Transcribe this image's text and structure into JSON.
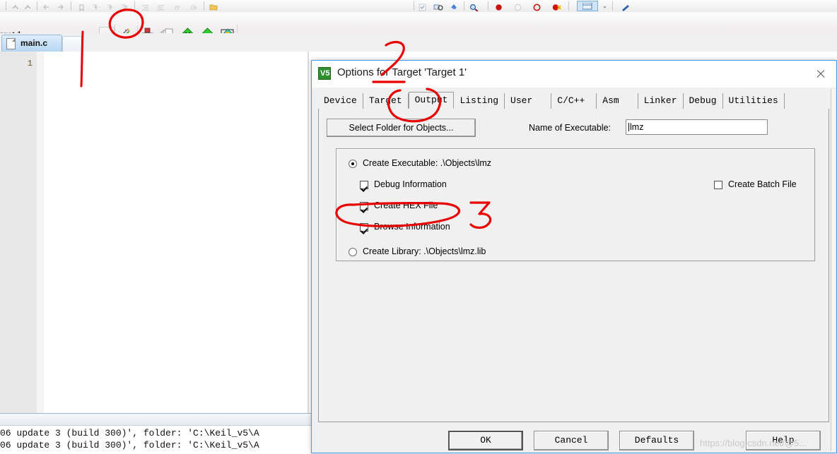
{
  "ide": {
    "target_label": "rget 1",
    "file_tab": {
      "label": "main.c",
      "icon": "document-icon"
    },
    "editor": {
      "line_number": "1"
    },
    "build_output": {
      "line1": "06 update 3 (build 300)', folder: 'C:\\Keil_v5\\A",
      "line2": "06 update 3 (build 300)', folder: 'C:\\Keil_v5\\A"
    },
    "toolbar": {
      "combo_arrow_icon": "chevron-down-icon",
      "icons": [
        "build-target-icon",
        "build-all-icon",
        "batch-build-icon",
        "translate-icon",
        "rebuild-icon",
        "options-target-icon"
      ],
      "row1_icons": [
        "undo-icon",
        "redo-icon",
        "back-icon",
        "forward-icon",
        "bookmark-icon",
        "prev-bookmark-icon",
        "next-bookmark-icon",
        "clear-bookmarks-icon",
        "indent-icon",
        "outdent-icon",
        "comment-icon",
        "uncomment-icon",
        "open-folder-icon"
      ],
      "row1_right_icons": [
        "checkbox-icon",
        "find-in-files-icon",
        "insert-icon",
        "zoom-icon",
        "breakpoint-icon",
        "breakpoint-off-icon",
        "breakpoint-disabled-icon",
        "breakpoint-kill-icon",
        "window-icon",
        "dropdown-icon",
        "debug-icon"
      ]
    }
  },
  "dialog": {
    "icon": "keil-v5-icon",
    "icon_text": "V5",
    "title": "Options for Target 'Target 1'",
    "close_icon": "close-icon",
    "tabs": [
      {
        "label": "Device",
        "selected": false
      },
      {
        "label": "Target",
        "selected": false
      },
      {
        "label": "Output",
        "selected": true
      },
      {
        "label": "Listing",
        "selected": false
      },
      {
        "label": "User",
        "selected": false
      },
      {
        "label": "C/C++",
        "selected": false
      },
      {
        "label": "Asm",
        "selected": false
      },
      {
        "label": "Linker",
        "selected": false
      },
      {
        "label": "Debug",
        "selected": false
      },
      {
        "label": "Utilities",
        "selected": false
      }
    ],
    "select_folder_button": "Select Folder for Objects...",
    "name_of_executable": {
      "label": "Name of Executable:",
      "value": "lmz"
    },
    "create_executable": {
      "label": "Create Executable:  .\\Objects\\lmz",
      "checked": true
    },
    "debug_information": {
      "label": "Debug Information",
      "checked": true
    },
    "create_hex_file": {
      "label": "Create HEX File",
      "checked": true
    },
    "browse_information": {
      "label": "Browse Information",
      "checked": true
    },
    "create_batch_file": {
      "label": "Create Batch File",
      "checked": false
    },
    "create_library": {
      "label": "Create Library:  .\\Objects\\lmz.lib",
      "checked": false
    },
    "buttons": {
      "ok": "OK",
      "cancel": "Cancel",
      "defaults": "Defaults",
      "help": "Help"
    }
  },
  "annotations": {
    "color": "#e60000",
    "marks": [
      {
        "name": "line-1-vertical",
        "kind": "line"
      },
      {
        "name": "circle-toolbar-icon",
        "kind": "circle"
      },
      {
        "name": "mark-2-arrow",
        "kind": "arrow"
      },
      {
        "name": "circle-output-tab",
        "kind": "circle"
      },
      {
        "name": "circle-create-hex",
        "kind": "circle"
      },
      {
        "name": "mark-3-digit",
        "kind": "digit",
        "text": "3"
      }
    ]
  },
  "watermark": {
    "text": "https://blog.csdn.net/@5..."
  }
}
